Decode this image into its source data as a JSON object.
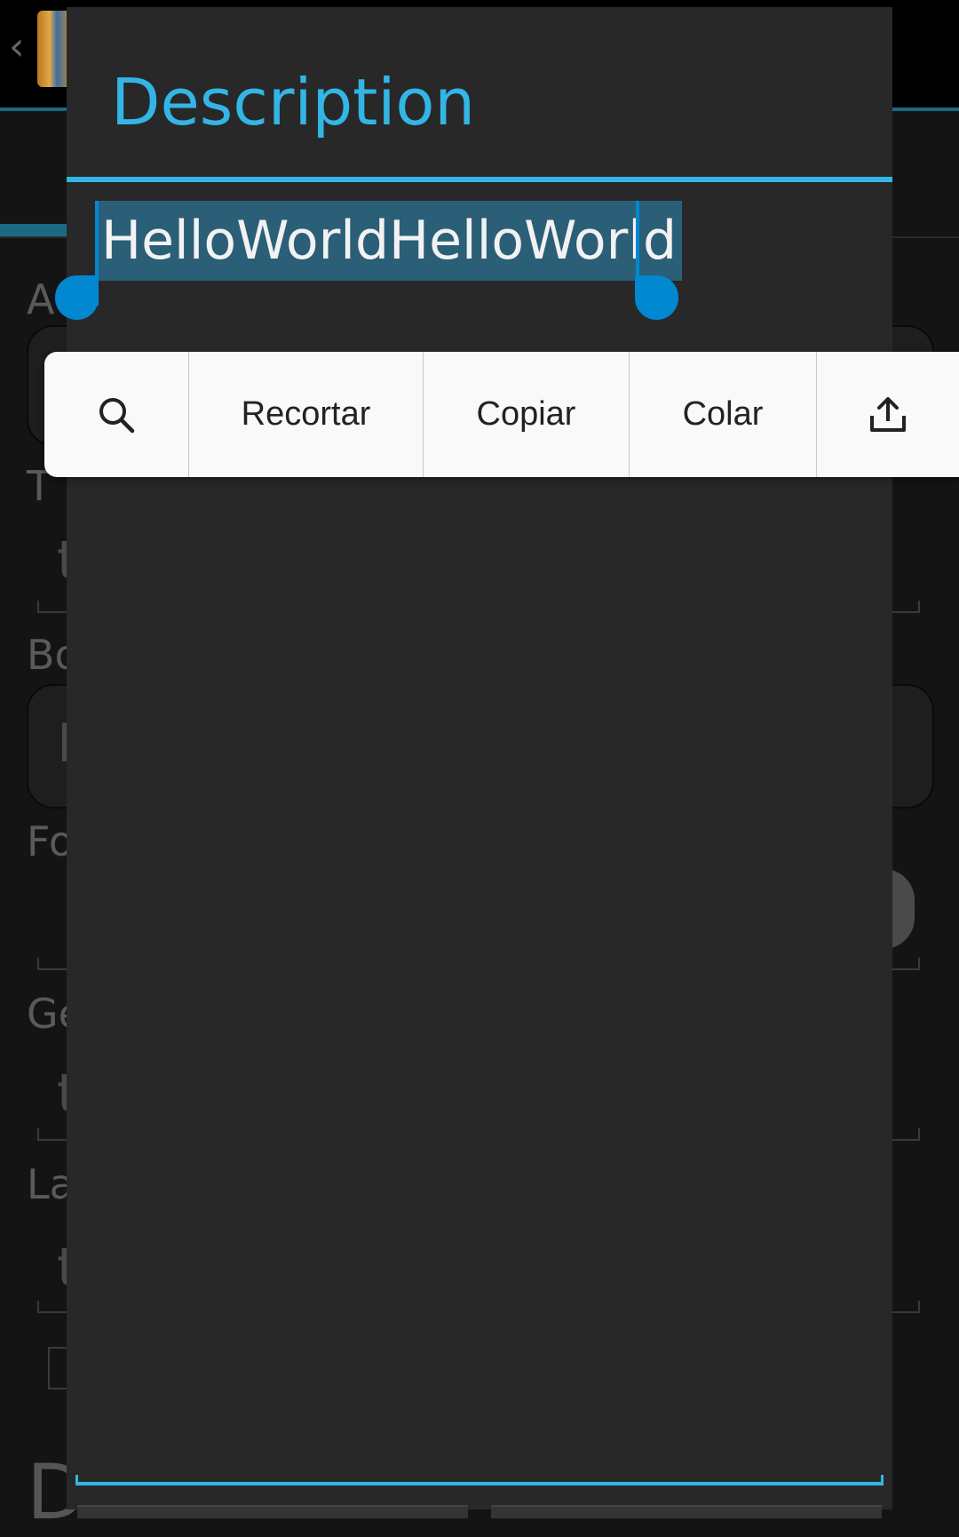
{
  "dialog": {
    "title": "Description",
    "selected_text": "HelloWorldHelloWorld"
  },
  "selection_toolbar": {
    "search_icon": "search-icon",
    "cut_label": "Recortar",
    "copy_label": "Copiar",
    "paste_label": "Colar",
    "share_icon": "share-icon"
  },
  "colors": {
    "accent": "#33b5e5",
    "selection_handle": "#0288d1",
    "selection_highlight": "#2a5f77",
    "dialog_background": "#282828",
    "toolbar_background": "#f9f9f9"
  }
}
